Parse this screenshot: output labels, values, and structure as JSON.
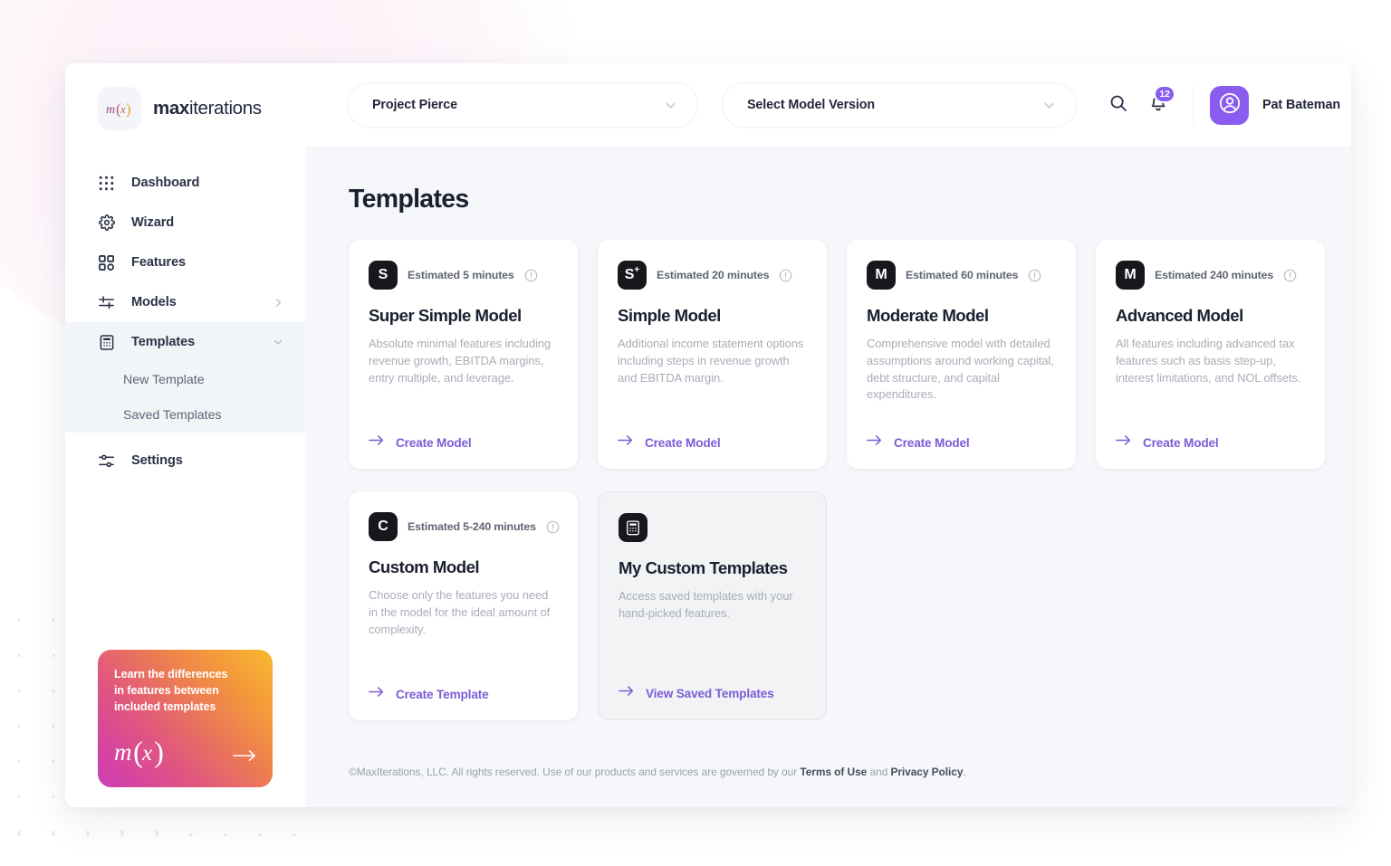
{
  "brand": {
    "mark_text": "m(x)",
    "name_bold": "max",
    "name_rest": "iterations"
  },
  "sidebar": {
    "items": [
      {
        "label": "Dashboard",
        "icon": "grid-icon"
      },
      {
        "label": "Wizard",
        "icon": "gear-icon"
      },
      {
        "label": "Features",
        "icon": "squares-icon"
      },
      {
        "label": "Models",
        "icon": "sliders-icon",
        "caret": "chevron-right-icon"
      },
      {
        "label": "Templates",
        "icon": "calculator-icon",
        "caret": "chevron-down-icon"
      },
      {
        "label": "Settings",
        "icon": "settings-sliders-icon"
      }
    ],
    "templates_children": [
      {
        "label": "New Template"
      },
      {
        "label": "Saved Templates"
      }
    ],
    "promo": {
      "line1": "Learn the differences",
      "line2": "in features between",
      "line3": "included templates",
      "logo": "m(x)",
      "arrow": "arrow-right-icon"
    }
  },
  "header": {
    "project_select": {
      "value": "Project Pierce",
      "caret": "chevron-down-icon"
    },
    "version_select": {
      "value": "Select Model Version",
      "caret": "chevron-down-icon"
    },
    "search_icon": "search-icon",
    "bell_icon": "bell-icon",
    "notification_count": "12",
    "user": {
      "name": "Pat Bateman",
      "avatar_icon": "user-avatar-icon",
      "caret": "chevron-down-icon"
    }
  },
  "main": {
    "title": "Templates",
    "cards": [
      {
        "badge": "S",
        "badge_sup": "",
        "estimate": "Estimated 5 minutes",
        "title": "Super Simple Model",
        "description": "Absolute minimal features including revenue growth, EBITDA margins, entry multiple, and leverage.",
        "link": "Create Model",
        "variant": "default"
      },
      {
        "badge": "S",
        "badge_sup": "+",
        "estimate": "Estimated 20 minutes",
        "title": "Simple Model",
        "description": "Additional income statement options including steps in revenue growth and EBITDA margin.",
        "link": "Create Model",
        "variant": "default"
      },
      {
        "badge": "M",
        "badge_sup": "",
        "estimate": "Estimated 60 minutes",
        "title": "Moderate Model",
        "description": "Comprehensive model with detailed assumptions around working capital, debt structure, and capital expenditures.",
        "link": "Create Model",
        "variant": "default"
      },
      {
        "badge": "M",
        "badge_sup": "",
        "estimate": "Estimated 240 minutes",
        "title": "Advanced Model",
        "description": "All features including advanced tax features such as basis step-up, interest limitations, and NOL offsets.",
        "link": "Create Model",
        "variant": "default"
      },
      {
        "badge": "C",
        "badge_sup": "",
        "estimate": "Estimated 5-240 minutes",
        "title": "Custom Model",
        "description": "Choose only the features you need in the model for the ideal amount of complexity.",
        "link": "Create Template",
        "variant": "default"
      },
      {
        "badge": "calculator-icon",
        "badge_sup": "",
        "estimate": "",
        "title": "My Custom Templates",
        "description": "Access saved templates with your hand-picked features.",
        "link": "View Saved Templates",
        "variant": "alt"
      }
    ]
  },
  "footer": {
    "text_before": "©MaxIterations, LLC. All rights reserved. Use of our products and services are governed by our ",
    "terms": "Terms of Use",
    "text_mid": " and ",
    "privacy": "Privacy Policy",
    "text_after": "."
  },
  "colors": {
    "accent_purple": "#8a5cf0",
    "link_purple": "#7c5cd6",
    "badge_dark": "#16181d",
    "content_bg": "#f5f7fa"
  }
}
